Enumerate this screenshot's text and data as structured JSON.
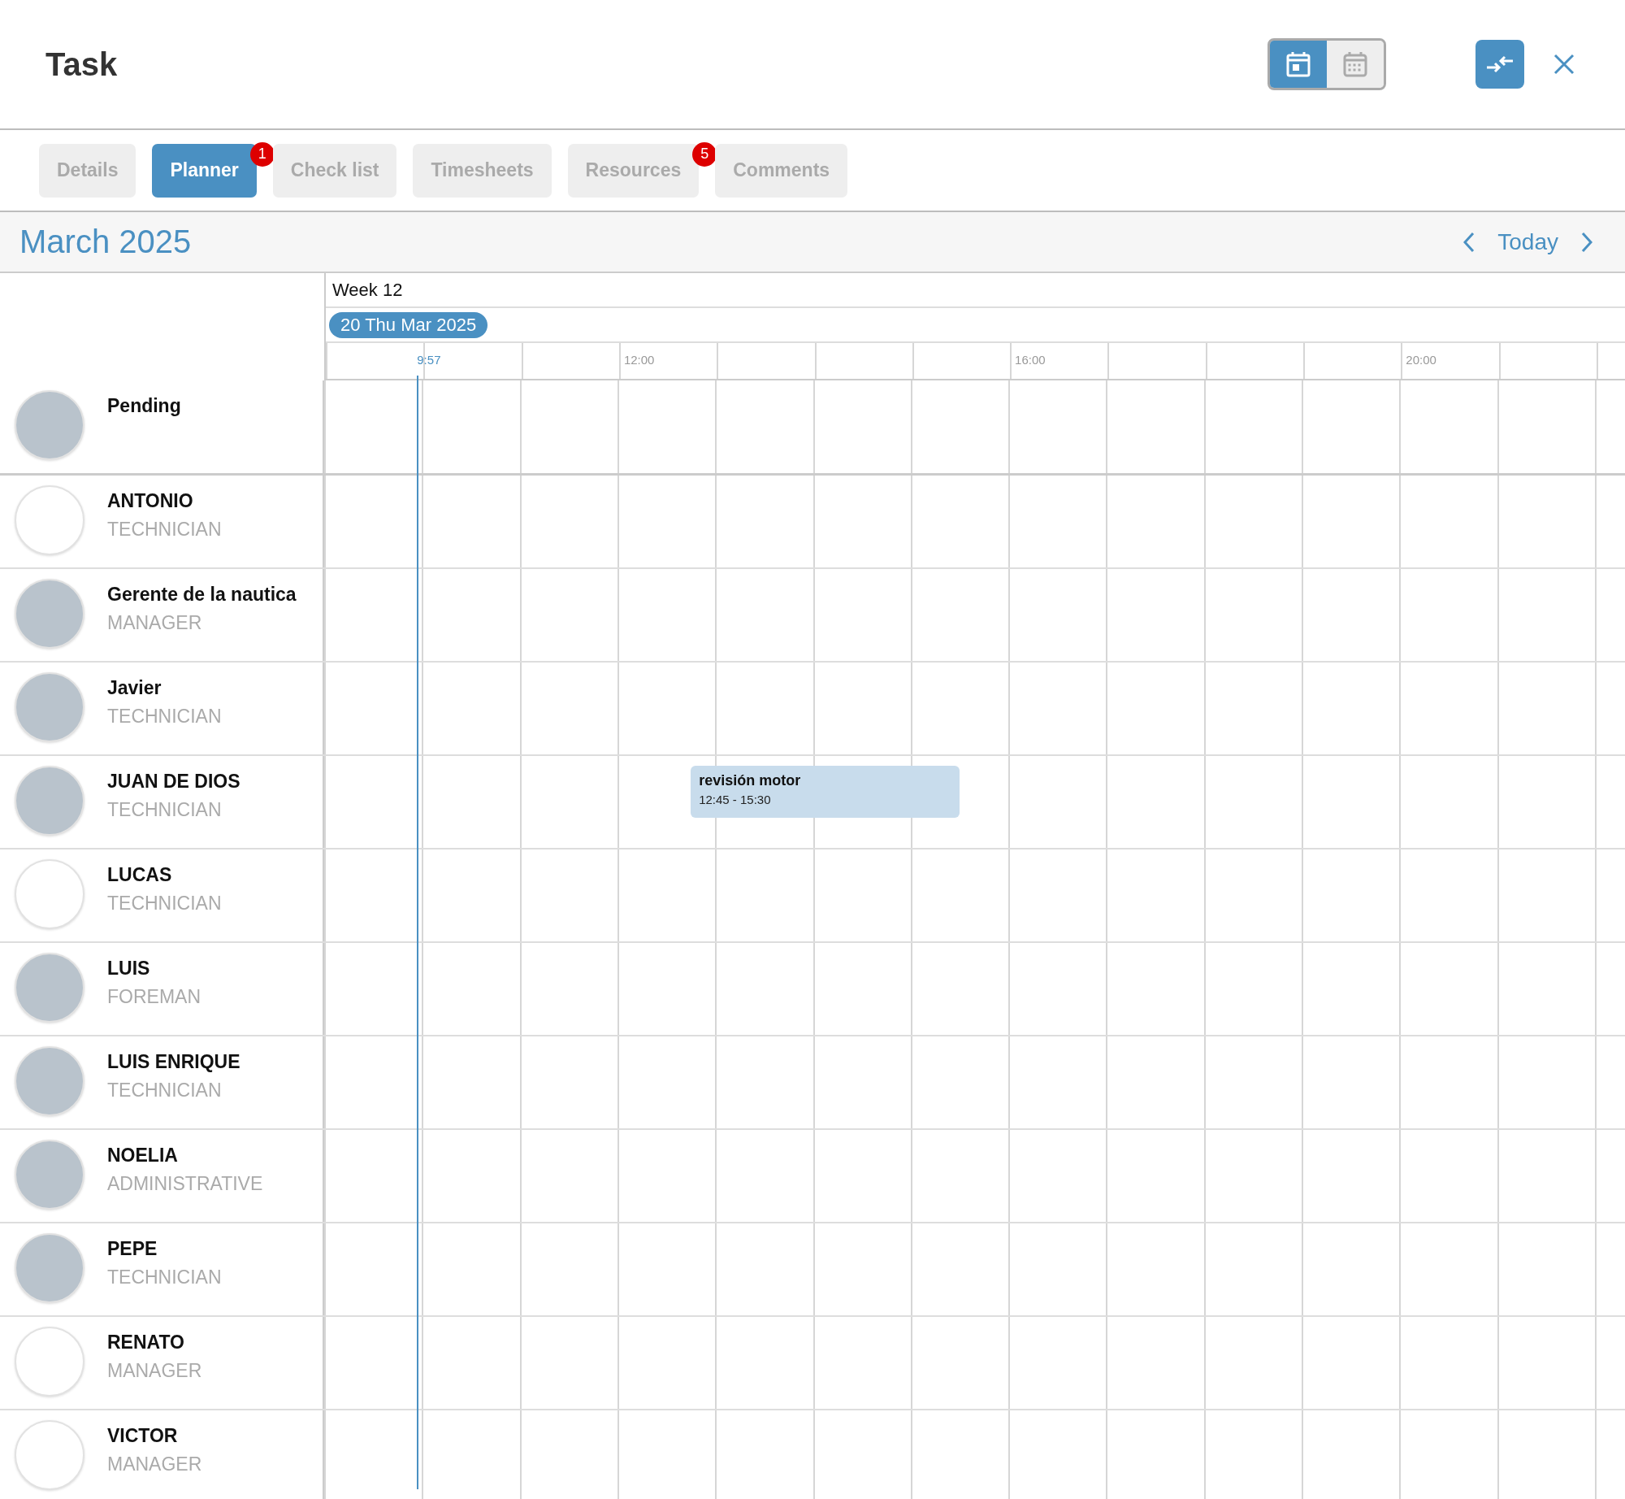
{
  "window": {
    "title": "Task"
  },
  "view_toggle": [
    {
      "kind": "day",
      "selected": true
    },
    {
      "kind": "month",
      "selected": false
    }
  ],
  "tabs": [
    {
      "label": "Details",
      "selected": false
    },
    {
      "label": "Planner",
      "selected": true,
      "badge": "1"
    },
    {
      "label": "Check list",
      "selected": false
    },
    {
      "label": "Timesheets",
      "selected": false
    },
    {
      "label": "Resources",
      "selected": false,
      "badge": "5"
    },
    {
      "label": "Comments",
      "selected": false
    }
  ],
  "planner": {
    "month": "March 2025",
    "today_button": "Today",
    "week": "Week 12",
    "date": "20 Thu Mar 2025",
    "now": "9:57",
    "time_labels": [
      "12:00",
      "16:00",
      "20:00"
    ],
    "rows": [
      {
        "name": "Pending",
        "role": "",
        "has_photo": true
      },
      {
        "name": "ANTONIO",
        "role": "TECHNICIAN",
        "has_photo": false
      },
      {
        "name": "Gerente de la nautica",
        "role": "MANAGER",
        "has_photo": true
      },
      {
        "name": "Javier",
        "role": "TECHNICIAN",
        "has_photo": true
      },
      {
        "name": "JUAN DE DIOS",
        "role": "TECHNICIAN",
        "has_photo": true,
        "events": [
          {
            "title": "revisión motor",
            "time": "12:45 - 15:30"
          }
        ]
      },
      {
        "name": "LUCAS",
        "role": "TECHNICIAN",
        "has_photo": false
      },
      {
        "name": "LUIS",
        "role": "FOREMAN",
        "has_photo": true
      },
      {
        "name": "LUIS ENRIQUE",
        "role": "TECHNICIAN",
        "has_photo": true
      },
      {
        "name": "NOELIA",
        "role": "ADMINISTRATIVE",
        "has_photo": true
      },
      {
        "name": "PEPE",
        "role": "TECHNICIAN",
        "has_photo": true
      },
      {
        "name": "RENATO",
        "role": "MANAGER",
        "has_photo": false
      },
      {
        "name": "VICTOR",
        "role": "MANAGER",
        "has_photo": false
      }
    ]
  }
}
